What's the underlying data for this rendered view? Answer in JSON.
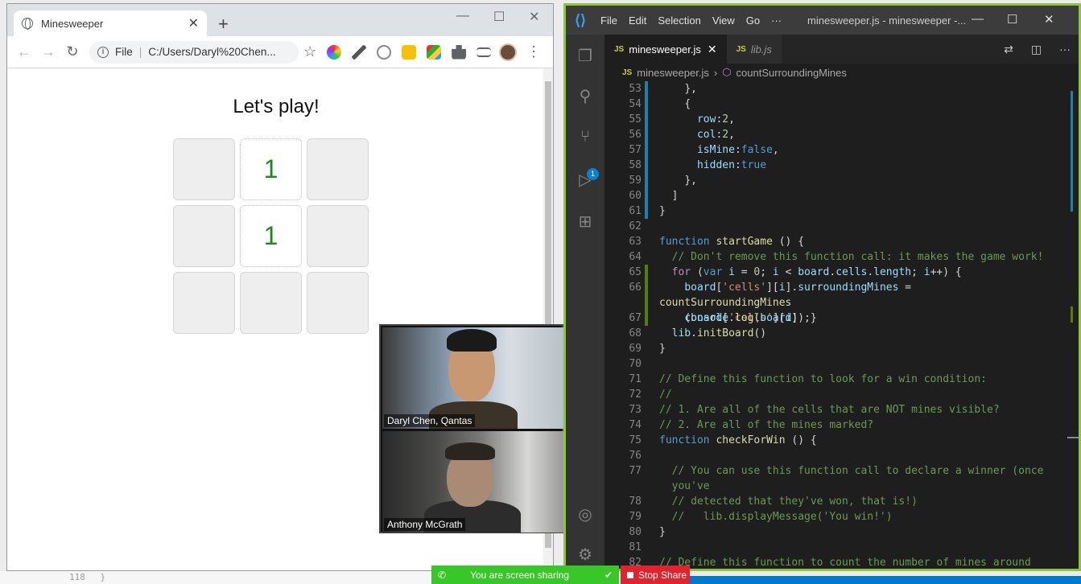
{
  "chrome": {
    "tab_title": "Minesweeper",
    "tab_close": "✕",
    "new_tab": "+",
    "minimize": "—",
    "maximize": "☐",
    "close": "✕",
    "back": "←",
    "forward": "→",
    "reload": "↻",
    "info": "i",
    "url_scheme": "File",
    "url": "C:/Users/Daryl%20Chen...",
    "star": "☆",
    "menu": "⋮"
  },
  "game": {
    "title": "Let's play!",
    "cells": [
      "",
      "1",
      "",
      "",
      "1",
      "",
      "",
      "",
      ""
    ],
    "revealed": [
      false,
      true,
      false,
      false,
      true,
      false,
      false,
      false,
      false
    ]
  },
  "vscode": {
    "menu": [
      "File",
      "Edit",
      "Selection",
      "View",
      "Go",
      "···"
    ],
    "window_title": "minesweeper.js - minesweeper -...",
    "minimize": "—",
    "maximize": "☐",
    "close": "✕",
    "tabs": [
      {
        "label": "minesweeper.js",
        "badge": "JS",
        "close": "✕"
      },
      {
        "label": "lib.js",
        "badge": "JS"
      }
    ],
    "breadcrumb_file": "minesweeper.js",
    "breadcrumb_symbol": "countSurroundingMines",
    "scm_badge": "1",
    "code": [
      {
        "ln": "53",
        "g": "mod-blue",
        "t": [
          [
            "    },",
            ""
          ]
        ]
      },
      {
        "ln": "54",
        "g": "mod-blue",
        "t": [
          [
            "    {",
            ""
          ]
        ]
      },
      {
        "ln": "55",
        "g": "mod-blue",
        "t": [
          [
            "      ",
            ""
          ],
          [
            "row",
            "tk-prop"
          ],
          [
            ":",
            ""
          ],
          [
            "2",
            "tk-num"
          ],
          [
            ",",
            ""
          ]
        ]
      },
      {
        "ln": "56",
        "g": "mod-blue",
        "t": [
          [
            "      ",
            ""
          ],
          [
            "col",
            "tk-prop"
          ],
          [
            ":",
            ""
          ],
          [
            "2",
            "tk-num"
          ],
          [
            ",",
            ""
          ]
        ]
      },
      {
        "ln": "57",
        "g": "mod-blue",
        "t": [
          [
            "      ",
            ""
          ],
          [
            "isMine",
            "tk-prop"
          ],
          [
            ":",
            ""
          ],
          [
            "false",
            "tk-kw"
          ],
          [
            ",",
            ""
          ]
        ]
      },
      {
        "ln": "58",
        "g": "mod-blue",
        "t": [
          [
            "      ",
            ""
          ],
          [
            "hidden",
            "tk-prop"
          ],
          [
            ":",
            ""
          ],
          [
            "true",
            "tk-kw"
          ]
        ]
      },
      {
        "ln": "59",
        "g": "mod-blue",
        "t": [
          [
            "    },",
            ""
          ]
        ]
      },
      {
        "ln": "60",
        "g": "mod-blue",
        "t": [
          [
            "  ]",
            ""
          ]
        ]
      },
      {
        "ln": "61",
        "g": "mod-blue",
        "t": [
          [
            "}",
            ""
          ]
        ]
      },
      {
        "ln": "62",
        "g": "",
        "t": [
          [
            "",
            ""
          ]
        ]
      },
      {
        "ln": "63",
        "g": "",
        "t": [
          [
            "function",
            "tk-kw"
          ],
          [
            " ",
            ""
          ],
          [
            "startGame",
            "tk-fn"
          ],
          [
            " () {",
            ""
          ]
        ]
      },
      {
        "ln": "64",
        "g": "",
        "t": [
          [
            "  ",
            ""
          ],
          [
            "// Don't remove this function call: it makes the game work!",
            "tk-cm"
          ]
        ]
      },
      {
        "ln": "65",
        "g": "mod-green",
        "t": [
          [
            "  ",
            ""
          ],
          [
            "for",
            "tk-ctl"
          ],
          [
            " (",
            ""
          ],
          [
            "var",
            "tk-kw"
          ],
          [
            " ",
            ""
          ],
          [
            "i",
            "tk-var"
          ],
          [
            " = ",
            ""
          ],
          [
            "0",
            "tk-num"
          ],
          [
            "; ",
            ""
          ],
          [
            "i",
            "tk-var"
          ],
          [
            " < ",
            ""
          ],
          [
            "board",
            "tk-var"
          ],
          [
            ".",
            ""
          ],
          [
            "cells",
            "tk-prop"
          ],
          [
            ".",
            ""
          ],
          [
            "length",
            "tk-prop"
          ],
          [
            "; ",
            ""
          ],
          [
            "i",
            "tk-var"
          ],
          [
            "++) {",
            ""
          ]
        ]
      },
      {
        "ln": "66",
        "g": "mod-green",
        "wrap": true,
        "t": [
          [
            "    ",
            ""
          ],
          [
            "board",
            "tk-var"
          ],
          [
            "[",
            ""
          ],
          [
            "'cells'",
            "tk-str"
          ],
          [
            "][",
            ""
          ],
          [
            "i",
            "tk-var"
          ],
          [
            "].",
            ""
          ],
          [
            "surroundingMines",
            "tk-prop"
          ],
          [
            " =  ",
            ""
          ],
          [
            "countSurroundingMines",
            "tk-fn"
          ],
          [
            "\n    (",
            ""
          ],
          [
            "board",
            "tk-var"
          ],
          [
            "[",
            ""
          ],
          [
            "'cells'",
            "tk-str"
          ],
          [
            "][",
            ""
          ],
          [
            "i",
            "tk-var"
          ],
          [
            "]);}",
            ""
          ]
        ]
      },
      {
        "ln": "67",
        "g": "mod-green",
        "t": [
          [
            "    ",
            ""
          ],
          [
            "console",
            "tk-var"
          ],
          [
            ".",
            ""
          ],
          [
            "log",
            "tk-fn"
          ],
          [
            "(",
            ""
          ],
          [
            "board",
            "tk-var"
          ],
          [
            ")",
            ""
          ]
        ]
      },
      {
        "ln": "68",
        "g": "",
        "t": [
          [
            "  ",
            ""
          ],
          [
            "lib",
            "tk-var"
          ],
          [
            ".",
            ""
          ],
          [
            "initBoard",
            "tk-fn"
          ],
          [
            "()",
            ""
          ]
        ]
      },
      {
        "ln": "69",
        "g": "",
        "t": [
          [
            "}",
            ""
          ]
        ]
      },
      {
        "ln": "70",
        "g": "",
        "t": [
          [
            "",
            ""
          ]
        ]
      },
      {
        "ln": "71",
        "g": "",
        "t": [
          [
            "// Define this function to look for a win condition:",
            "tk-cm"
          ]
        ]
      },
      {
        "ln": "72",
        "g": "",
        "t": [
          [
            "//",
            "tk-cm"
          ]
        ]
      },
      {
        "ln": "73",
        "g": "",
        "t": [
          [
            "// 1. Are all of the cells that are NOT mines visible?",
            "tk-cm"
          ]
        ]
      },
      {
        "ln": "74",
        "g": "",
        "t": [
          [
            "// 2. Are all of the mines marked?",
            "tk-cm"
          ]
        ]
      },
      {
        "ln": "75",
        "g": "",
        "t": [
          [
            "function",
            "tk-kw"
          ],
          [
            " ",
            ""
          ],
          [
            "checkForWin",
            "tk-fn"
          ],
          [
            " () {",
            ""
          ]
        ]
      },
      {
        "ln": "76",
        "g": "",
        "t": [
          [
            "",
            ""
          ]
        ]
      },
      {
        "ln": "77",
        "g": "",
        "wrap": true,
        "t": [
          [
            "  ",
            ""
          ],
          [
            "// You can use this function call to declare a winner (once\n  you've",
            "tk-cm"
          ]
        ]
      },
      {
        "ln": "78",
        "g": "",
        "t": [
          [
            "  ",
            ""
          ],
          [
            "// detected that they've won, that is!)",
            "tk-cm"
          ]
        ]
      },
      {
        "ln": "79",
        "g": "",
        "t": [
          [
            "  ",
            ""
          ],
          [
            "//   lib.displayMessage('You win!')",
            "tk-cm"
          ]
        ]
      },
      {
        "ln": "80",
        "g": "",
        "t": [
          [
            "}",
            ""
          ]
        ]
      },
      {
        "ln": "81",
        "g": "",
        "t": [
          [
            "",
            ""
          ]
        ]
      },
      {
        "ln": "82",
        "g": "",
        "wrap": true,
        "t": [
          [
            "// Define this function to count the number of mines around\n  cell",
            "tk-cm"
          ]
        ]
      }
    ]
  },
  "zoom": {
    "participant_1": "Daryl Chen, Qantas",
    "participant_2": "Anthony McGrath",
    "sharing_text": "You are screen sharing",
    "stop_share": "Stop Share"
  },
  "background": {
    "line_number": "118",
    "code": "}"
  }
}
